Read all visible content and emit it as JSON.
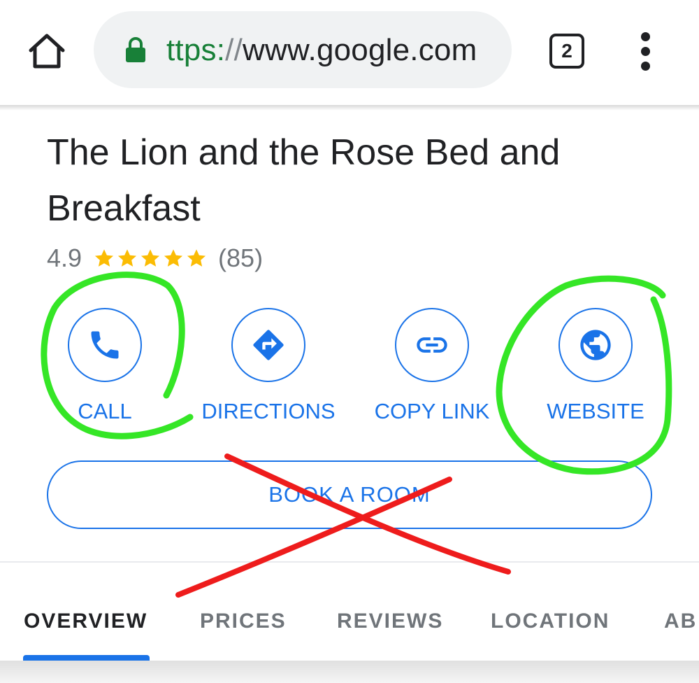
{
  "browser": {
    "url_scheme": "ttps:",
    "url_separator": "//",
    "url_host": "www.google.com",
    "tab_count": "2",
    "icons": {
      "home": "home-icon",
      "lock": "lock-icon",
      "menu": "more-vertical-icon"
    }
  },
  "listing": {
    "name": "The Lion and the Rose Bed and Breakfast",
    "rating": "4.9",
    "stars": 5,
    "review_count": "(85)",
    "star_color": "#fbbc04"
  },
  "actions": [
    {
      "label": "CALL",
      "icon": "phone-icon"
    },
    {
      "label": "DIRECTIONS",
      "icon": "directions-icon"
    },
    {
      "label": "COPY LINK",
      "icon": "link-icon"
    },
    {
      "label": "WEBSITE",
      "icon": "globe-icon"
    }
  ],
  "book_button": {
    "label": "BOOK A ROOM"
  },
  "tabs": [
    {
      "label": "OVERVIEW",
      "active": true
    },
    {
      "label": "PRICES",
      "active": false
    },
    {
      "label": "REVIEWS",
      "active": false
    },
    {
      "label": "LOCATION",
      "active": false
    },
    {
      "label": "AB",
      "active": false
    }
  ],
  "colors": {
    "accent": "#1a73e8",
    "annotation_highlight": "#35e626",
    "annotation_strike": "#ee1c1c"
  }
}
